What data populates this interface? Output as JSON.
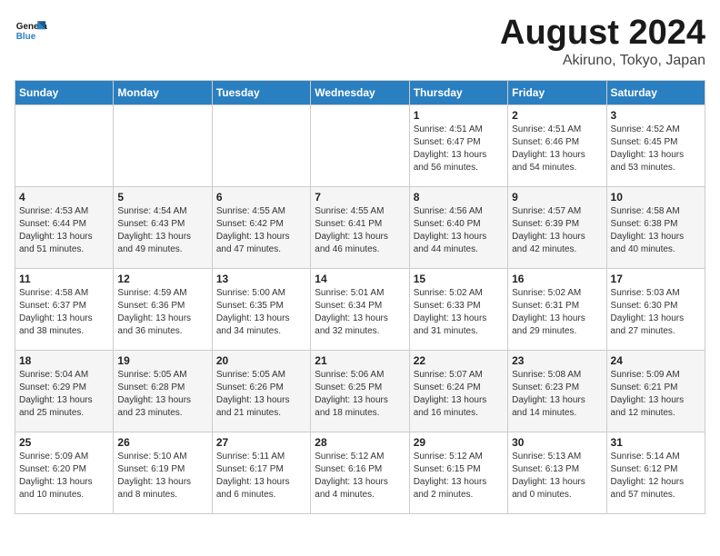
{
  "header": {
    "logo_general": "General",
    "logo_blue": "Blue",
    "month_year": "August 2024",
    "location": "Akiruno, Tokyo, Japan"
  },
  "days_of_week": [
    "Sunday",
    "Monday",
    "Tuesday",
    "Wednesday",
    "Thursday",
    "Friday",
    "Saturday"
  ],
  "weeks": [
    [
      {
        "day": "",
        "info": ""
      },
      {
        "day": "",
        "info": ""
      },
      {
        "day": "",
        "info": ""
      },
      {
        "day": "",
        "info": ""
      },
      {
        "day": "1",
        "info": "Sunrise: 4:51 AM\nSunset: 6:47 PM\nDaylight: 13 hours\nand 56 minutes."
      },
      {
        "day": "2",
        "info": "Sunrise: 4:51 AM\nSunset: 6:46 PM\nDaylight: 13 hours\nand 54 minutes."
      },
      {
        "day": "3",
        "info": "Sunrise: 4:52 AM\nSunset: 6:45 PM\nDaylight: 13 hours\nand 53 minutes."
      }
    ],
    [
      {
        "day": "4",
        "info": "Sunrise: 4:53 AM\nSunset: 6:44 PM\nDaylight: 13 hours\nand 51 minutes."
      },
      {
        "day": "5",
        "info": "Sunrise: 4:54 AM\nSunset: 6:43 PM\nDaylight: 13 hours\nand 49 minutes."
      },
      {
        "day": "6",
        "info": "Sunrise: 4:55 AM\nSunset: 6:42 PM\nDaylight: 13 hours\nand 47 minutes."
      },
      {
        "day": "7",
        "info": "Sunrise: 4:55 AM\nSunset: 6:41 PM\nDaylight: 13 hours\nand 46 minutes."
      },
      {
        "day": "8",
        "info": "Sunrise: 4:56 AM\nSunset: 6:40 PM\nDaylight: 13 hours\nand 44 minutes."
      },
      {
        "day": "9",
        "info": "Sunrise: 4:57 AM\nSunset: 6:39 PM\nDaylight: 13 hours\nand 42 minutes."
      },
      {
        "day": "10",
        "info": "Sunrise: 4:58 AM\nSunset: 6:38 PM\nDaylight: 13 hours\nand 40 minutes."
      }
    ],
    [
      {
        "day": "11",
        "info": "Sunrise: 4:58 AM\nSunset: 6:37 PM\nDaylight: 13 hours\nand 38 minutes."
      },
      {
        "day": "12",
        "info": "Sunrise: 4:59 AM\nSunset: 6:36 PM\nDaylight: 13 hours\nand 36 minutes."
      },
      {
        "day": "13",
        "info": "Sunrise: 5:00 AM\nSunset: 6:35 PM\nDaylight: 13 hours\nand 34 minutes."
      },
      {
        "day": "14",
        "info": "Sunrise: 5:01 AM\nSunset: 6:34 PM\nDaylight: 13 hours\nand 32 minutes."
      },
      {
        "day": "15",
        "info": "Sunrise: 5:02 AM\nSunset: 6:33 PM\nDaylight: 13 hours\nand 31 minutes."
      },
      {
        "day": "16",
        "info": "Sunrise: 5:02 AM\nSunset: 6:31 PM\nDaylight: 13 hours\nand 29 minutes."
      },
      {
        "day": "17",
        "info": "Sunrise: 5:03 AM\nSunset: 6:30 PM\nDaylight: 13 hours\nand 27 minutes."
      }
    ],
    [
      {
        "day": "18",
        "info": "Sunrise: 5:04 AM\nSunset: 6:29 PM\nDaylight: 13 hours\nand 25 minutes."
      },
      {
        "day": "19",
        "info": "Sunrise: 5:05 AM\nSunset: 6:28 PM\nDaylight: 13 hours\nand 23 minutes."
      },
      {
        "day": "20",
        "info": "Sunrise: 5:05 AM\nSunset: 6:26 PM\nDaylight: 13 hours\nand 21 minutes."
      },
      {
        "day": "21",
        "info": "Sunrise: 5:06 AM\nSunset: 6:25 PM\nDaylight: 13 hours\nand 18 minutes."
      },
      {
        "day": "22",
        "info": "Sunrise: 5:07 AM\nSunset: 6:24 PM\nDaylight: 13 hours\nand 16 minutes."
      },
      {
        "day": "23",
        "info": "Sunrise: 5:08 AM\nSunset: 6:23 PM\nDaylight: 13 hours\nand 14 minutes."
      },
      {
        "day": "24",
        "info": "Sunrise: 5:09 AM\nSunset: 6:21 PM\nDaylight: 13 hours\nand 12 minutes."
      }
    ],
    [
      {
        "day": "25",
        "info": "Sunrise: 5:09 AM\nSunset: 6:20 PM\nDaylight: 13 hours\nand 10 minutes."
      },
      {
        "day": "26",
        "info": "Sunrise: 5:10 AM\nSunset: 6:19 PM\nDaylight: 13 hours\nand 8 minutes."
      },
      {
        "day": "27",
        "info": "Sunrise: 5:11 AM\nSunset: 6:17 PM\nDaylight: 13 hours\nand 6 minutes."
      },
      {
        "day": "28",
        "info": "Sunrise: 5:12 AM\nSunset: 6:16 PM\nDaylight: 13 hours\nand 4 minutes."
      },
      {
        "day": "29",
        "info": "Sunrise: 5:12 AM\nSunset: 6:15 PM\nDaylight: 13 hours\nand 2 minutes."
      },
      {
        "day": "30",
        "info": "Sunrise: 5:13 AM\nSunset: 6:13 PM\nDaylight: 13 hours\nand 0 minutes."
      },
      {
        "day": "31",
        "info": "Sunrise: 5:14 AM\nSunset: 6:12 PM\nDaylight: 12 hours\nand 57 minutes."
      }
    ]
  ]
}
